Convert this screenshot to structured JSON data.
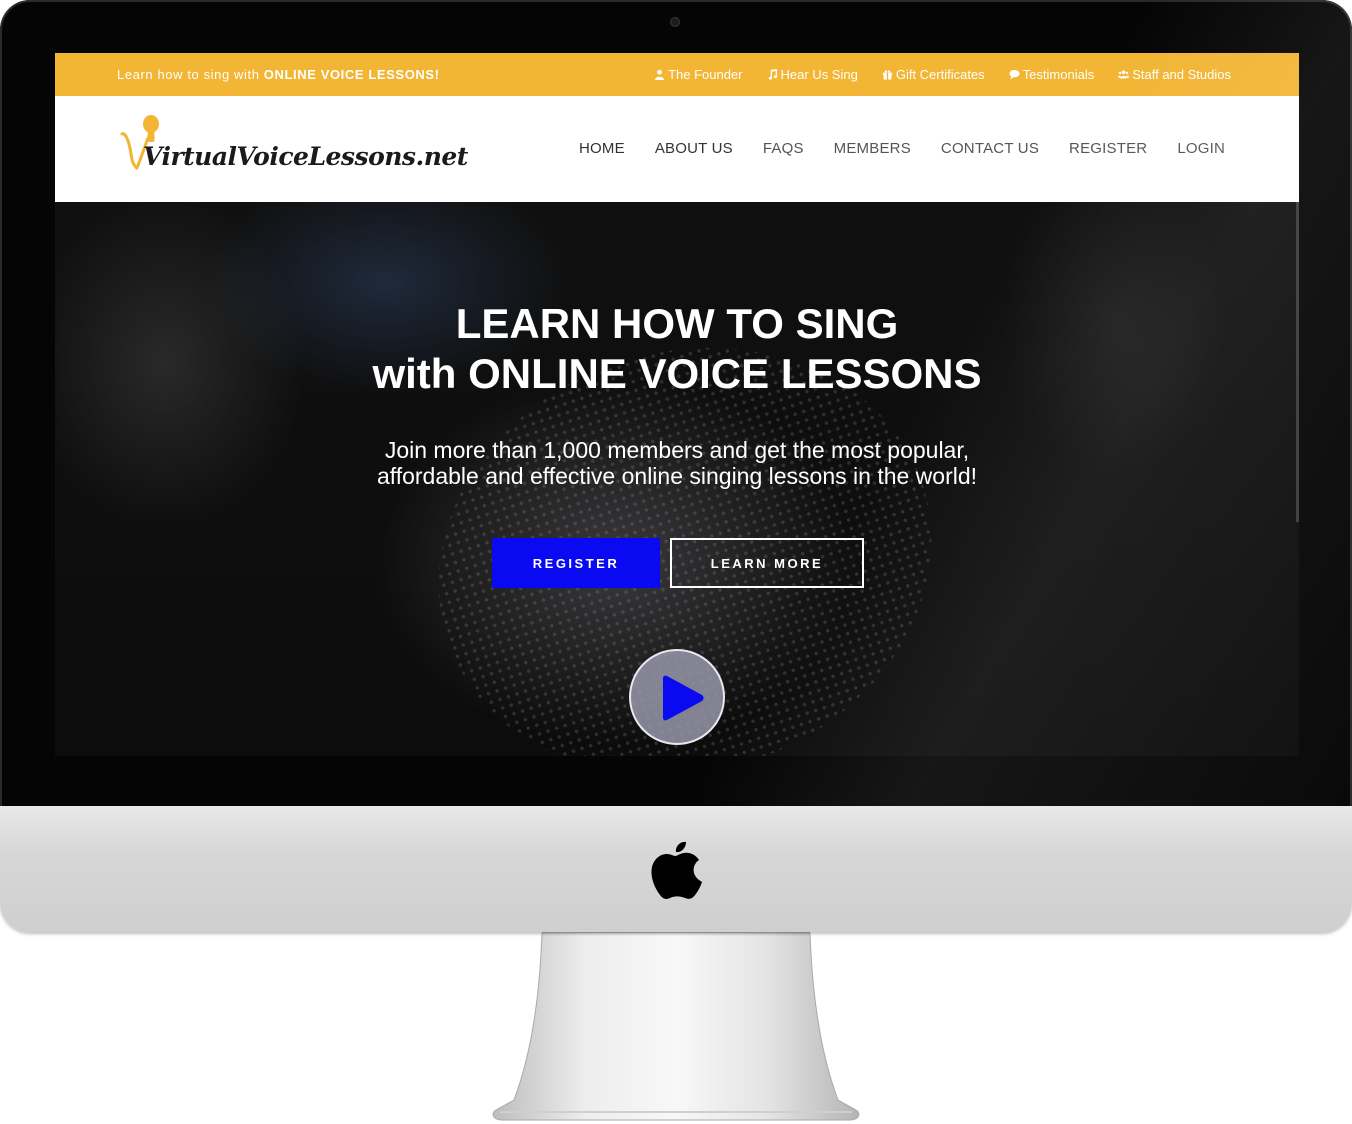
{
  "colors": {
    "topbar_bg": "#f2b534",
    "register_button": "#0a0af2",
    "logo_accent": "#f2b534"
  },
  "topbar": {
    "tagline_prefix": "Learn how to sing with ",
    "tagline_bold": "ONLINE VOICE LESSONS!",
    "links": [
      {
        "label": "The Founder",
        "icon": "user-icon"
      },
      {
        "label": "Hear Us Sing",
        "icon": "music-note-icon"
      },
      {
        "label": "Gift Certificates",
        "icon": "gift-icon"
      },
      {
        "label": "Testimonials",
        "icon": "comment-icon"
      },
      {
        "label": "Staff and Studios",
        "icon": "users-icon"
      }
    ]
  },
  "logo": {
    "text": "VirtualVoiceLessons.net",
    "icon": "microphone-icon"
  },
  "nav": {
    "items": [
      "HOME",
      "ABOUT US",
      "FAQS",
      "MEMBERS",
      "CONTACT US",
      "REGISTER",
      "LOGIN"
    ]
  },
  "hero": {
    "title_line1": "LEARN HOW TO SING",
    "title_line2": "with ONLINE VOICE LESSONS",
    "subtitle_line1": "Join more than 1,000 members and get the most popular,",
    "subtitle_line2": "affordable and effective online singing lessons in the world!",
    "register_label": "REGISTER",
    "learn_more_label": "LEARN MORE",
    "play_icon": "play-icon"
  }
}
